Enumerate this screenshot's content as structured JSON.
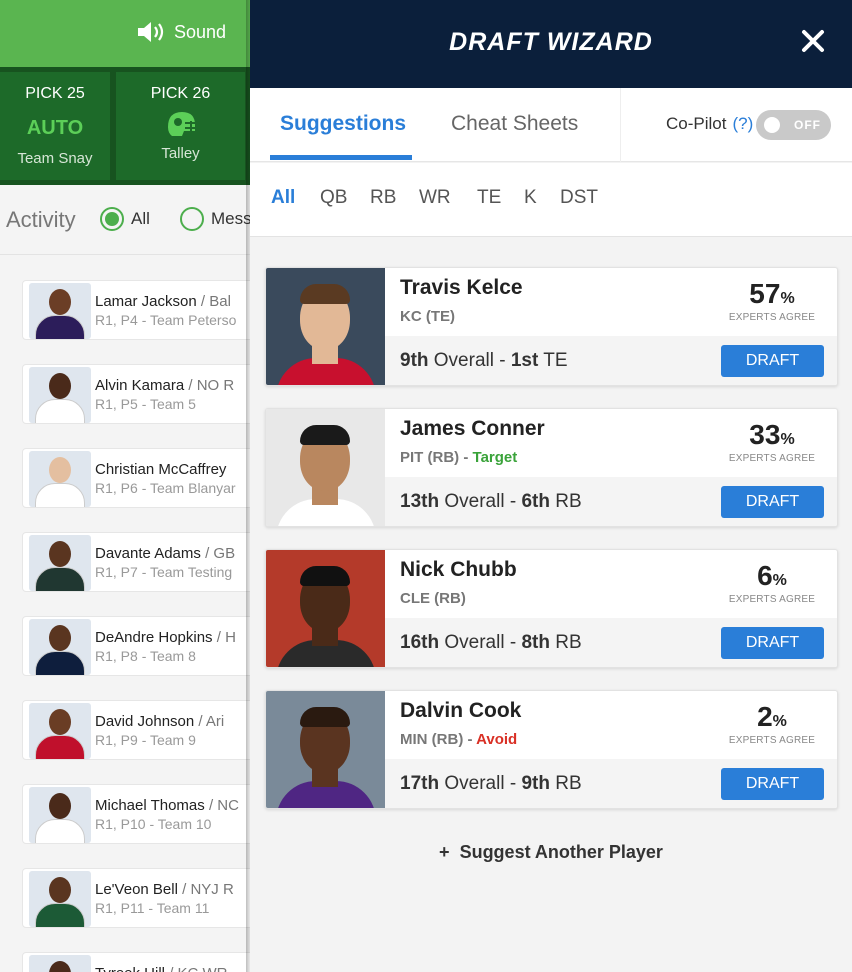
{
  "background_app": {
    "sound_label": "Sound",
    "picks": [
      {
        "label": "PICK 25",
        "status": "AUTO",
        "team": "Team Snay"
      },
      {
        "label": "PICK 26",
        "status": "",
        "team": "Talley"
      }
    ],
    "activity": {
      "title": "Activity",
      "filters": [
        {
          "label": "All",
          "selected": true
        },
        {
          "label": "Mess",
          "selected": false
        }
      ]
    },
    "feed": [
      {
        "name": "Lamar Jackson",
        "team": "/ Bal",
        "detail": "R1, P4 - Team Peterso",
        "skin": "#6b3e26",
        "jersey": "#2c1d5a"
      },
      {
        "name": "Alvin Kamara",
        "team": "/ NO R",
        "detail": "R1, P5 - Team 5",
        "skin": "#4a2a1a",
        "jersey": "#ffffff"
      },
      {
        "name": "Christian McCaffrey",
        "team": "",
        "detail": "R1, P6 - Team Blanyar",
        "skin": "#e4bfa0",
        "jersey": "#ffffff"
      },
      {
        "name": "Davante Adams",
        "team": "/ GB",
        "detail": "R1, P7 - Team Testing",
        "skin": "#5a3520",
        "jersey": "#203731"
      },
      {
        "name": "DeAndre Hopkins",
        "team": "/ H",
        "detail": "R1, P8 - Team 8",
        "skin": "#5a3520",
        "jersey": "#0e1e3d"
      },
      {
        "name": "David Johnson",
        "team": "/ Ari",
        "detail": "R1, P9 - Team 9",
        "skin": "#6a3d24",
        "jersey": "#c0102c"
      },
      {
        "name": "Michael Thomas",
        "team": "/ NC",
        "detail": "R1, P10 - Team 10",
        "skin": "#4a2a1a",
        "jersey": "#ffffff"
      },
      {
        "name": "Le'Veon Bell",
        "team": "/ NYJ R",
        "detail": "R1, P11 - Team 11",
        "skin": "#5a3520",
        "jersey": "#1c5a36"
      },
      {
        "name": "Tyreek Hill",
        "team": "/ KC WR",
        "detail": "",
        "skin": "#4a2a1a",
        "jersey": "#c0102c"
      }
    ]
  },
  "wizard": {
    "title": "DRAFT WIZARD",
    "close_icon": "close-icon",
    "tabs": [
      {
        "label": "Suggestions",
        "active": true
      },
      {
        "label": "Cheat Sheets",
        "active": false
      }
    ],
    "copilot": {
      "label": "Co-Pilot",
      "help": "(?)",
      "toggle_label": "OFF"
    },
    "positions": [
      {
        "label": "All",
        "active": true
      },
      {
        "label": "QB",
        "active": false
      },
      {
        "label": "RB",
        "active": false
      },
      {
        "label": "WR",
        "active": false
      },
      {
        "label": "TE",
        "active": false
      },
      {
        "label": "K",
        "active": false
      },
      {
        "label": "DST",
        "active": false
      }
    ],
    "experts_agree_label": "EXPERTS AGREE",
    "draft_label": "DRAFT",
    "players": [
      {
        "name": "Travis Kelce",
        "team_pos": "KC (TE)",
        "tag": "",
        "tag_type": "",
        "percent": "57",
        "overall": "9th",
        "overall_label": "Overall",
        "pos_rank": "1st",
        "pos": "TE",
        "skin": "#e2b896",
        "jersey": "#c8102e",
        "bg": "#3a4a5c",
        "hair": "#5a3a22"
      },
      {
        "name": "James Conner",
        "team_pos": "PIT (RB)",
        "tag": "Target",
        "tag_type": "target",
        "percent": "33",
        "overall": "13th",
        "overall_label": "Overall",
        "pos_rank": "6th",
        "pos": "RB",
        "skin": "#b9875f",
        "jersey": "#ffffff",
        "bg": "#e8e8e8",
        "hair": "#1a1a1a"
      },
      {
        "name": "Nick Chubb",
        "team_pos": "CLE (RB)",
        "tag": "",
        "tag_type": "",
        "percent": "6",
        "overall": "16th",
        "overall_label": "Overall",
        "pos_rank": "8th",
        "pos": "RB",
        "skin": "#4a2a18",
        "jersey": "#2a2a2a",
        "bg": "#b43a2a",
        "hair": "#111111"
      },
      {
        "name": "Dalvin Cook",
        "team_pos": "MIN (RB)",
        "tag": "Avoid",
        "tag_type": "avoid",
        "percent": "2",
        "overall": "17th",
        "overall_label": "Overall",
        "pos_rank": "9th",
        "pos": "RB",
        "skin": "#5a3420",
        "jersey": "#4f2683",
        "bg": "#7a8a99",
        "hair": "#2a1a10"
      }
    ],
    "suggest_another": "Suggest Another Player",
    "colors": {
      "header_bg": "#0b1f3b",
      "accent": "#2a7ed8",
      "target": "#3aa33a",
      "avoid": "#d93025",
      "topbar": "#5ab550"
    }
  }
}
